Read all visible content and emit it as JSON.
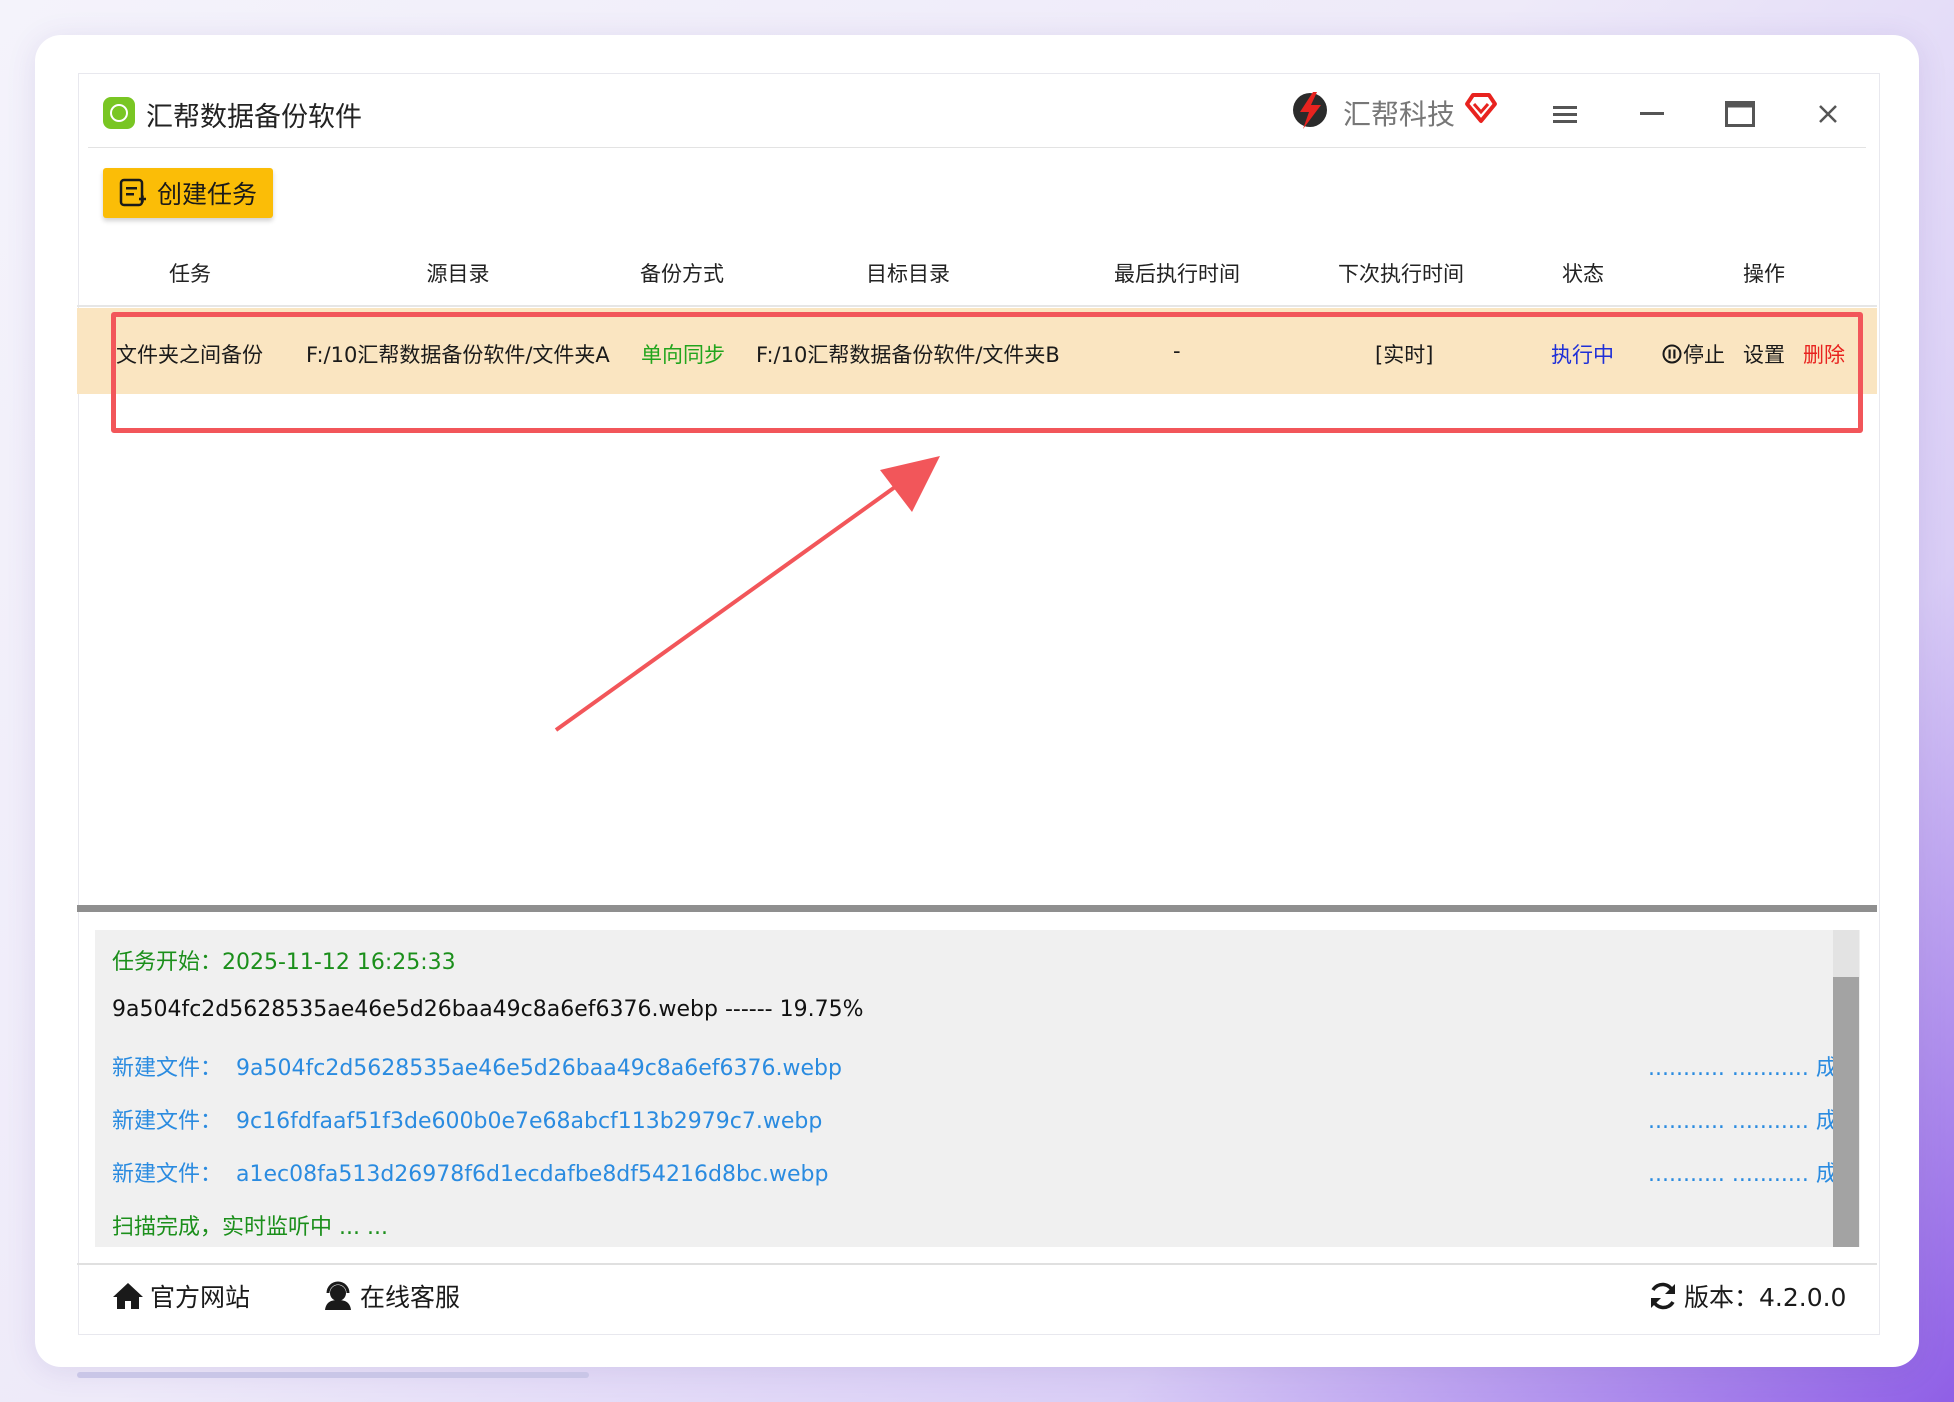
{
  "app": {
    "title": "汇帮数据备份软件",
    "brand": "汇帮科技"
  },
  "toolbar": {
    "create_label": "创建任务"
  },
  "table": {
    "headers": {
      "task": "任务",
      "source": "源目录",
      "mode": "备份方式",
      "target": "目标目录",
      "last_run": "最后执行时间",
      "next_run": "下次执行时间",
      "status": "状态",
      "actions": "操作"
    },
    "rows": [
      {
        "task": "文件夹之间备份",
        "source": "F:/10汇帮数据备份软件/文件夹A",
        "mode": "单向同步",
        "target": "F:/10汇帮数据备份软件/文件夹B",
        "last_run": "-",
        "next_run": "[实时]",
        "status": "执行中",
        "stop": "停止",
        "settings": "设置",
        "delete": "删除"
      }
    ]
  },
  "log": {
    "start": "任务开始：2025-11-12 16:25:33",
    "progress": "9a504fc2d5628535ae46e5d26baa49c8a6ef6376.webp ------ 19.75%",
    "entries": [
      {
        "label": "新建文件：",
        "file": "9a504fc2d5628535ae46e5d26baa49c8a6ef6376.webp",
        "result": "........... ........... 成功"
      },
      {
        "label": "新建文件：",
        "file": "9c16fdfaaf51f3de600b0e7e68abcf113b2979c7.webp",
        "result": "........... ........... 成功"
      },
      {
        "label": "新建文件：",
        "file": "a1ec08fa513d26978f6d1ecdafbe8df54216d8bc.webp",
        "result": "........... ........... 成功"
      }
    ],
    "done": "扫描完成，实时监听中 ... ..."
  },
  "footer": {
    "website": "官方网站",
    "support": "在线客服",
    "version": "版本：4.2.0.0"
  },
  "colors": {
    "accent": "#fbbd07",
    "row_highlight": "#fae5c1",
    "annotation": "#f2565a",
    "status_running": "#1e2fd8",
    "sync_mode": "#22a51d",
    "delete": "#e8231f",
    "log_link": "#2a8be0"
  }
}
